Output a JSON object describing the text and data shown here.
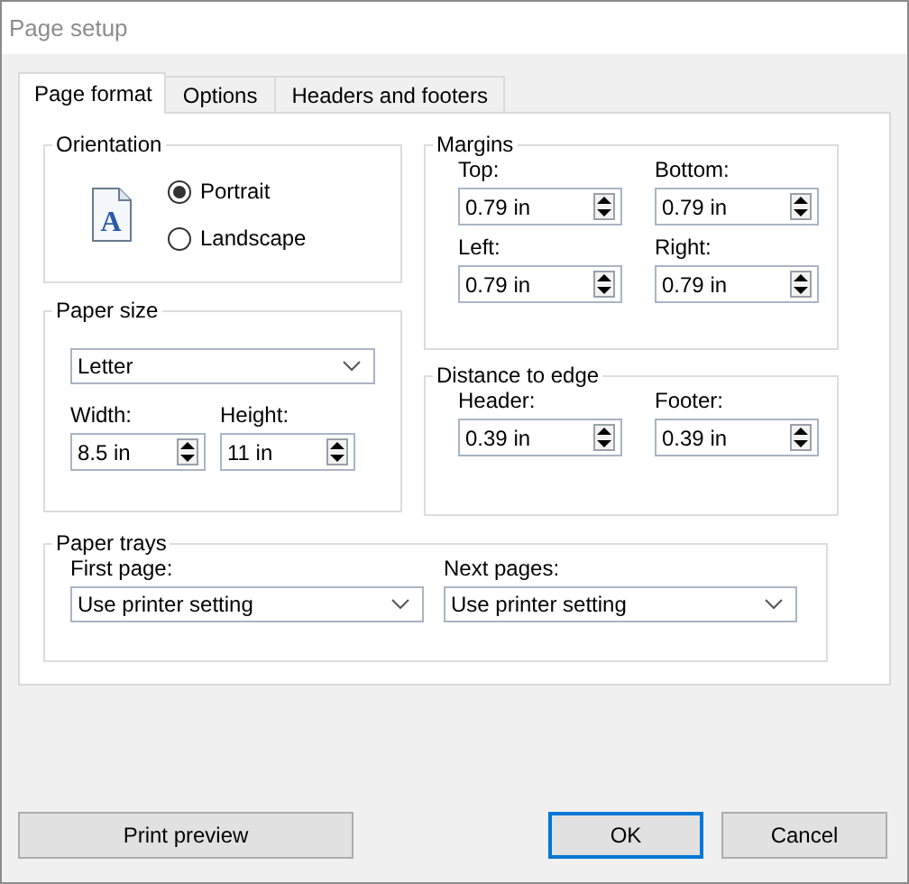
{
  "window": {
    "title": "Page setup"
  },
  "tabs": [
    {
      "label": "Page format",
      "selected": true
    },
    {
      "label": "Options",
      "selected": false
    },
    {
      "label": "Headers and footers",
      "selected": false
    }
  ],
  "orientation": {
    "title": "Orientation",
    "icon_letter": "A",
    "options": [
      {
        "label": "Portrait",
        "selected": true
      },
      {
        "label": "Landscape",
        "selected": false
      }
    ]
  },
  "paper_size": {
    "title": "Paper size",
    "size": "Letter",
    "fields": [
      {
        "label": "Width:",
        "value": "8.5 in"
      },
      {
        "label": "Height:",
        "value": "11 in"
      }
    ]
  },
  "margins": {
    "title": "Margins",
    "fields": [
      {
        "label": "Top:",
        "value": "0.79 in"
      },
      {
        "label": "Bottom:",
        "value": "0.79 in"
      },
      {
        "label": "Left:",
        "value": "0.79 in"
      },
      {
        "label": "Right:",
        "value": "0.79 in"
      }
    ]
  },
  "distance_to_edge": {
    "title": "Distance to edge",
    "fields": [
      {
        "label": "Header:",
        "value": "0.39 in"
      },
      {
        "label": "Footer:",
        "value": "0.39 in"
      }
    ]
  },
  "paper_trays": {
    "title": "Paper trays",
    "fields": [
      {
        "label": "First page:",
        "value": "Use printer setting"
      },
      {
        "label": "Next pages:",
        "value": "Use printer setting"
      }
    ]
  },
  "buttons": [
    {
      "label": "Print preview",
      "default": false
    },
    {
      "label": "OK",
      "default": true
    },
    {
      "label": "Cancel",
      "default": false
    }
  ]
}
